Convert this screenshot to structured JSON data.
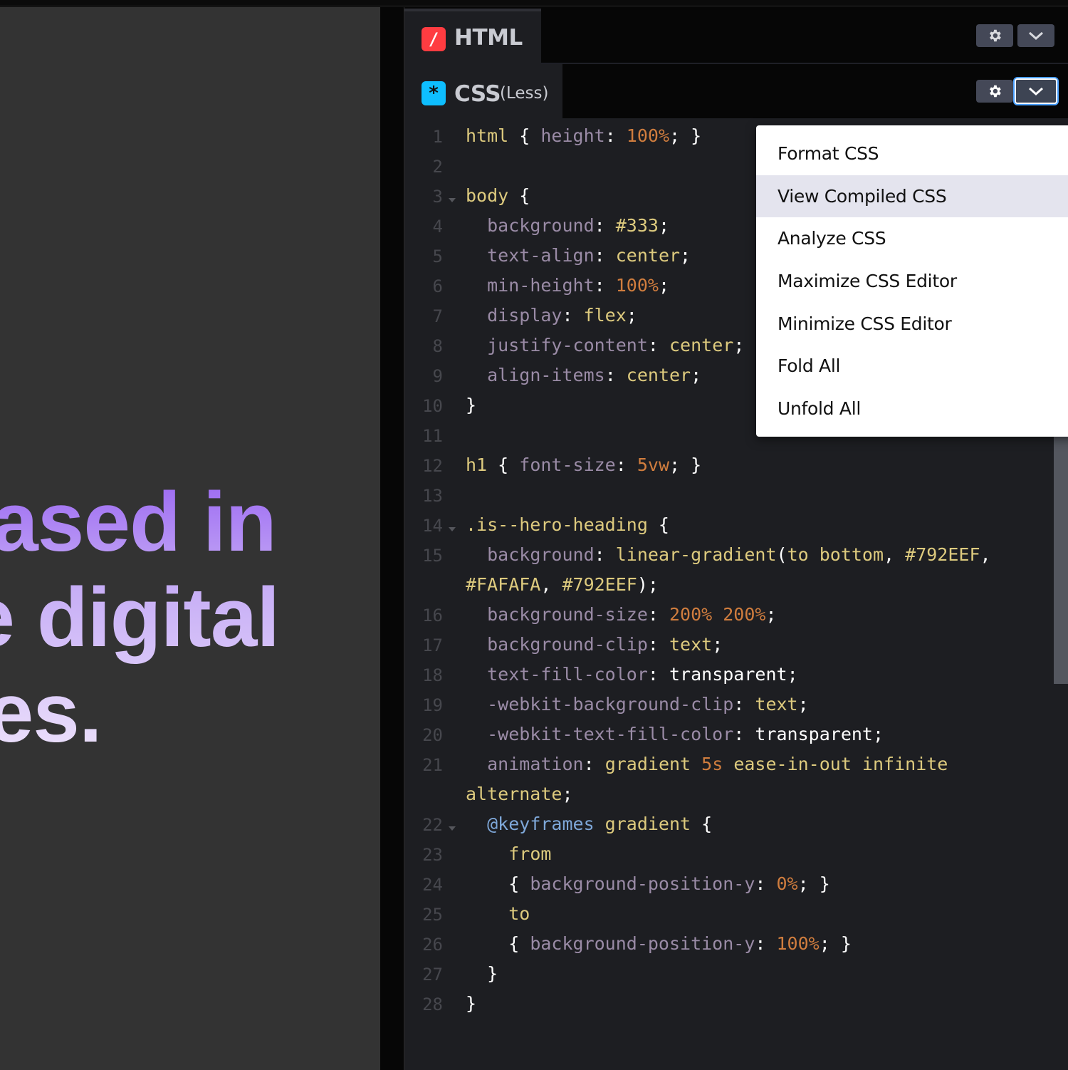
{
  "preview": {
    "hero_lines": [
      "based in",
      "te digital",
      "ces."
    ]
  },
  "html_panel": {
    "badge": "/",
    "title": "HTML",
    "settings_icon": "gear-icon",
    "dropdown_icon": "chevron-down-icon"
  },
  "css_panel": {
    "badge": "*",
    "title": "CSS",
    "subtitle": "(Less)",
    "settings_icon": "gear-icon",
    "dropdown_icon": "chevron-down-icon"
  },
  "colors": {
    "preview_bg": "#333333",
    "editor_bg": "#1d1e22",
    "html_badge": "#ff3c41",
    "css_badge": "#0ebeff",
    "hero_gradient_top": "#792EEF",
    "hero_gradient_bottom": "#FAFAFA",
    "menu_highlight": "#e4e4ee"
  },
  "code_lines": [
    {
      "n": "1",
      "fold": false,
      "segs": [
        [
          "sel",
          "html"
        ],
        [
          "punc",
          " { "
        ],
        [
          "prop",
          "height"
        ],
        [
          "punc",
          ": "
        ],
        [
          "num",
          "100%"
        ],
        [
          "punc",
          "; }"
        ]
      ]
    },
    {
      "n": "2",
      "fold": false,
      "segs": []
    },
    {
      "n": "3",
      "fold": true,
      "segs": [
        [
          "sel",
          "body"
        ],
        [
          "punc",
          " {"
        ]
      ]
    },
    {
      "n": "4",
      "fold": false,
      "segs": [
        [
          "punc",
          "  "
        ],
        [
          "prop",
          "background"
        ],
        [
          "punc",
          ": "
        ],
        [
          "val",
          "#333"
        ],
        [
          "punc",
          ";"
        ]
      ]
    },
    {
      "n": "5",
      "fold": false,
      "segs": [
        [
          "punc",
          "  "
        ],
        [
          "prop",
          "text-align"
        ],
        [
          "punc",
          ": "
        ],
        [
          "val",
          "center"
        ],
        [
          "punc",
          ";"
        ]
      ]
    },
    {
      "n": "6",
      "fold": false,
      "segs": [
        [
          "punc",
          "  "
        ],
        [
          "prop",
          "min-height"
        ],
        [
          "punc",
          ": "
        ],
        [
          "num",
          "100%"
        ],
        [
          "punc",
          ";"
        ]
      ]
    },
    {
      "n": "7",
      "fold": false,
      "segs": [
        [
          "punc",
          "  "
        ],
        [
          "prop",
          "display"
        ],
        [
          "punc",
          ": "
        ],
        [
          "val",
          "flex"
        ],
        [
          "punc",
          ";"
        ]
      ]
    },
    {
      "n": "8",
      "fold": false,
      "segs": [
        [
          "punc",
          "  "
        ],
        [
          "prop",
          "justify-content"
        ],
        [
          "punc",
          ": "
        ],
        [
          "val",
          "center"
        ],
        [
          "punc",
          ";"
        ]
      ]
    },
    {
      "n": "9",
      "fold": false,
      "segs": [
        [
          "punc",
          "  "
        ],
        [
          "prop",
          "align-items"
        ],
        [
          "punc",
          ": "
        ],
        [
          "val",
          "center"
        ],
        [
          "punc",
          ";"
        ]
      ]
    },
    {
      "n": "10",
      "fold": false,
      "segs": [
        [
          "punc",
          "}"
        ]
      ]
    },
    {
      "n": "11",
      "fold": false,
      "segs": []
    },
    {
      "n": "12",
      "fold": false,
      "segs": [
        [
          "sel",
          "h1"
        ],
        [
          "punc",
          " { "
        ],
        [
          "prop",
          "font-size"
        ],
        [
          "punc",
          ": "
        ],
        [
          "num",
          "5vw"
        ],
        [
          "punc",
          "; }"
        ]
      ]
    },
    {
      "n": "13",
      "fold": false,
      "segs": []
    },
    {
      "n": "14",
      "fold": true,
      "segs": [
        [
          "sel",
          ".is--hero-heading"
        ],
        [
          "punc",
          " {"
        ]
      ]
    },
    {
      "n": "15",
      "fold": false,
      "segs": [
        [
          "punc",
          "  "
        ],
        [
          "prop",
          "background"
        ],
        [
          "punc",
          ": "
        ],
        [
          "val",
          "linear-gradient"
        ],
        [
          "punc",
          "("
        ],
        [
          "val",
          "to bottom"
        ],
        [
          "punc",
          ", "
        ],
        [
          "val",
          "#792EEF"
        ],
        [
          "punc",
          ","
        ]
      ]
    },
    {
      "n": "",
      "fold": false,
      "segs": [
        [
          "val",
          "#FAFAFA"
        ],
        [
          "punc",
          ", "
        ],
        [
          "val",
          "#792EEF"
        ],
        [
          "punc",
          ");"
        ]
      ]
    },
    {
      "n": "16",
      "fold": false,
      "segs": [
        [
          "punc",
          "  "
        ],
        [
          "prop",
          "background-size"
        ],
        [
          "punc",
          ": "
        ],
        [
          "num",
          "200% 200%"
        ],
        [
          "punc",
          ";"
        ]
      ]
    },
    {
      "n": "17",
      "fold": false,
      "segs": [
        [
          "punc",
          "  "
        ],
        [
          "prop",
          "background-clip"
        ],
        [
          "punc",
          ": "
        ],
        [
          "val",
          "text"
        ],
        [
          "punc",
          ";"
        ]
      ]
    },
    {
      "n": "18",
      "fold": false,
      "segs": [
        [
          "punc",
          "  "
        ],
        [
          "prop",
          "text-fill-color"
        ],
        [
          "punc",
          ": "
        ],
        [
          "plain",
          "transparent"
        ],
        [
          "punc",
          ";"
        ]
      ]
    },
    {
      "n": "19",
      "fold": false,
      "segs": [
        [
          "punc",
          "  "
        ],
        [
          "prop",
          "-webkit-background-clip"
        ],
        [
          "punc",
          ": "
        ],
        [
          "val",
          "text"
        ],
        [
          "punc",
          ";"
        ]
      ]
    },
    {
      "n": "20",
      "fold": false,
      "segs": [
        [
          "punc",
          "  "
        ],
        [
          "prop",
          "-webkit-text-fill-color"
        ],
        [
          "punc",
          ": "
        ],
        [
          "plain",
          "transparent"
        ],
        [
          "punc",
          ";"
        ]
      ]
    },
    {
      "n": "21",
      "fold": false,
      "segs": [
        [
          "punc",
          "  "
        ],
        [
          "prop",
          "animation"
        ],
        [
          "punc",
          ": "
        ],
        [
          "val",
          "gradient "
        ],
        [
          "num",
          "5s"
        ],
        [
          "val",
          " ease-in-out infinite"
        ]
      ]
    },
    {
      "n": "",
      "fold": false,
      "segs": [
        [
          "val",
          "alternate"
        ],
        [
          "punc",
          ";"
        ]
      ]
    },
    {
      "n": "22",
      "fold": true,
      "segs": [
        [
          "punc",
          "  "
        ],
        [
          "at",
          "@keyframes"
        ],
        [
          "val",
          " gradient"
        ],
        [
          "punc",
          " {"
        ]
      ]
    },
    {
      "n": "23",
      "fold": false,
      "segs": [
        [
          "punc",
          "    "
        ],
        [
          "sel",
          "from"
        ]
      ]
    },
    {
      "n": "24",
      "fold": false,
      "segs": [
        [
          "punc",
          "    { "
        ],
        [
          "prop",
          "background-position-y"
        ],
        [
          "punc",
          ": "
        ],
        [
          "num",
          "0%"
        ],
        [
          "punc",
          "; }"
        ]
      ]
    },
    {
      "n": "25",
      "fold": false,
      "segs": [
        [
          "punc",
          "    "
        ],
        [
          "sel",
          "to"
        ]
      ]
    },
    {
      "n": "26",
      "fold": false,
      "segs": [
        [
          "punc",
          "    { "
        ],
        [
          "prop",
          "background-position-y"
        ],
        [
          "punc",
          ": "
        ],
        [
          "num",
          "100%"
        ],
        [
          "punc",
          "; }"
        ]
      ]
    },
    {
      "n": "27",
      "fold": false,
      "segs": [
        [
          "punc",
          "  }"
        ]
      ]
    },
    {
      "n": "28",
      "fold": false,
      "segs": [
        [
          "punc",
          "}"
        ]
      ]
    }
  ],
  "menu": {
    "items": [
      {
        "label": "Format CSS",
        "highlighted": false
      },
      {
        "label": "View Compiled CSS",
        "highlighted": true
      },
      {
        "label": "Analyze CSS",
        "highlighted": false
      },
      {
        "label": "Maximize CSS Editor",
        "highlighted": false
      },
      {
        "label": "Minimize CSS Editor",
        "highlighted": false
      },
      {
        "label": "Fold All",
        "highlighted": false
      },
      {
        "label": "Unfold All",
        "highlighted": false
      }
    ]
  }
}
